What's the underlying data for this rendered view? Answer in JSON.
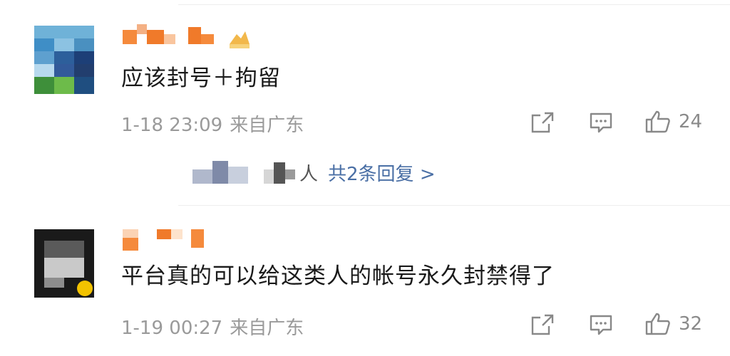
{
  "comments": [
    {
      "text": "应该封号＋拘留",
      "time": "1-18 23:09",
      "location": "来自广东",
      "likes": "24",
      "reply_suffix": "人",
      "reply_link": "共2条回复 >"
    },
    {
      "text": "平台真的可以给这类人的帐号永久封禁得了",
      "time": "1-19 00:27",
      "location": "来自广东",
      "likes": "32"
    }
  ],
  "icons": {
    "share": "share-icon",
    "comment": "comment-icon",
    "like": "thumbs-up-icon",
    "badge": "member-badge-icon"
  },
  "colors": {
    "text": "#1a1a1a",
    "meta": "#9a9a9a",
    "link": "#4a6fa5",
    "name_orange": "#f07a2a"
  }
}
